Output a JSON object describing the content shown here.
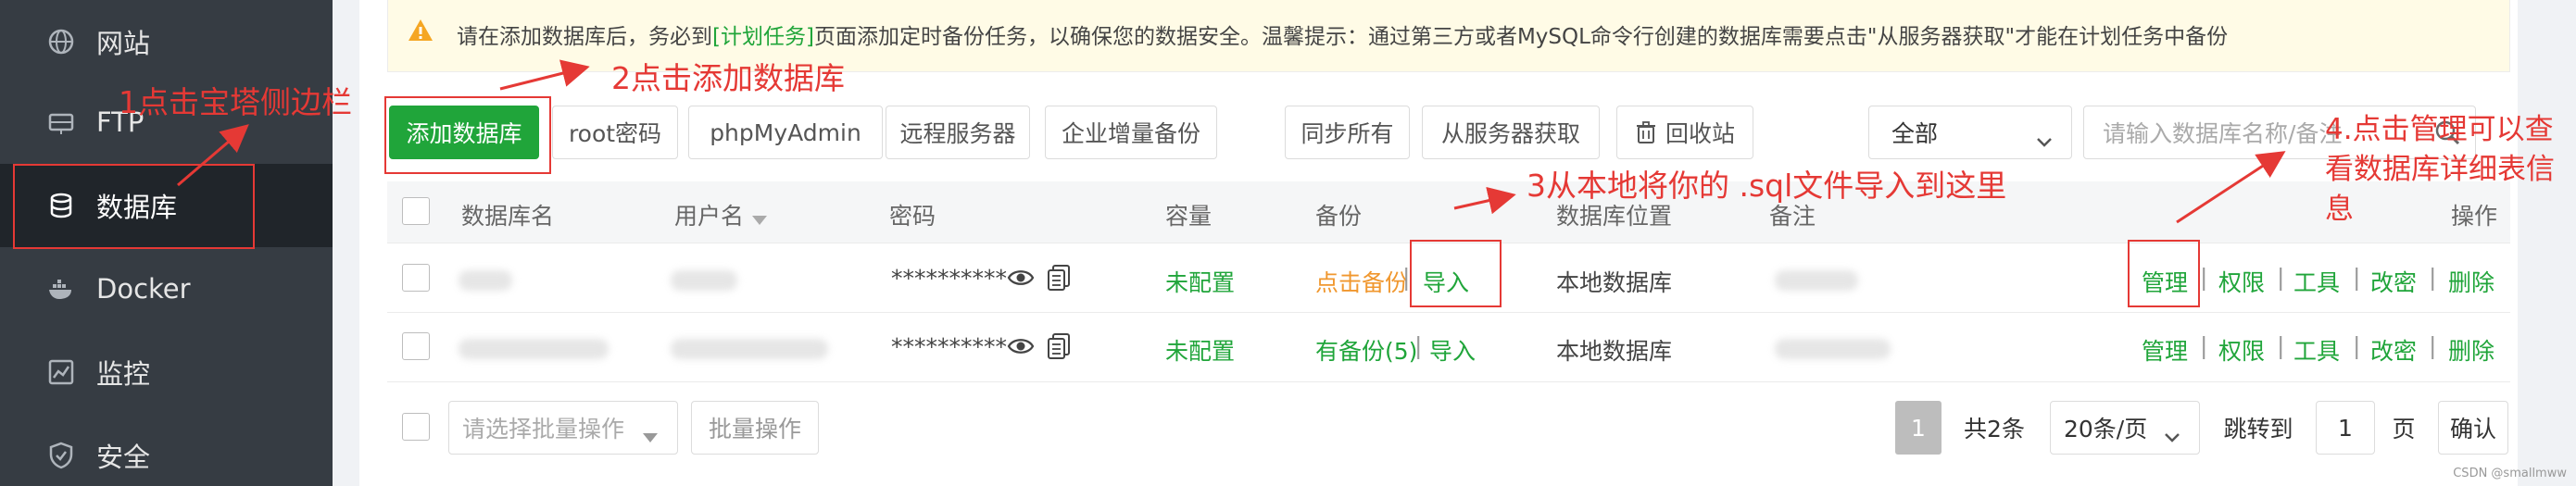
{
  "sidebar": {
    "items": [
      {
        "label": "网站",
        "icon": "globe-icon"
      },
      {
        "label": "FTP",
        "icon": "ftp-icon"
      },
      {
        "label": "数据库",
        "icon": "database-icon",
        "active": true
      },
      {
        "label": "Docker",
        "icon": "docker-icon"
      },
      {
        "label": "监控",
        "icon": "monitor-icon"
      },
      {
        "label": "安全",
        "icon": "shield-icon"
      }
    ]
  },
  "tip": {
    "prefix": "请在添加数据库后，务必到",
    "link": "[计划任务]",
    "suffix": "页面添加定时备份任务，以确保您的数据安全。温馨提示：通过第三方或者MySQL命令行创建的数据库需要点击\"从服务器获取\"才能在计划任务中备份"
  },
  "toolbar": {
    "add_db": "添加数据库",
    "root_pwd": "root密码",
    "phpmyadmin": "phpMyAdmin",
    "remote_server": "远程服务器",
    "enterprise_backup": "企业增量备份",
    "sync_all": "同步所有",
    "get_from_server": "从服务器获取",
    "recycle_bin": "回收站",
    "filter_select": "全部",
    "search_placeholder": "请输入数据库名称/备注"
  },
  "table": {
    "headers": [
      "数据库名",
      "用户名",
      "密码",
      "容量",
      "备份",
      "数据库位置",
      "备注",
      "操作"
    ],
    "rows": [
      {
        "password": "**********",
        "capacity": "未配置",
        "backup": "点击备份",
        "import": "导入",
        "location": "本地数据库",
        "actions": [
          "管理",
          "权限",
          "工具",
          "改密",
          "删除"
        ]
      },
      {
        "password": "**********",
        "capacity": "未配置",
        "backup": "有备份(5)",
        "import": "导入",
        "location": "本地数据库",
        "actions": [
          "管理",
          "权限",
          "工具",
          "改密",
          "删除"
        ]
      }
    ]
  },
  "footer": {
    "batch_placeholder": "请选择批量操作",
    "batch_button": "批量操作",
    "current_page": "1",
    "total": "共2条",
    "per_page": "20条/页",
    "jump_label": "跳转到",
    "jump_value": "1",
    "page_unit": "页",
    "confirm": "确认"
  },
  "annotations": {
    "step1": "1点击宝塔侧边栏",
    "step2": "2点击添加数据库",
    "step3": "3从本地将你的 .sql文件导入到这里",
    "step4_line1": "4.点击管理可以查",
    "step4_line2": "看数据库详细表信",
    "step4_line3": "息"
  },
  "watermark": "CSDN @smallmww",
  "colors": {
    "accent": "#20a53a",
    "annotation": "#e53935",
    "sidebar": "#363c43",
    "orange": "#f0972e"
  }
}
